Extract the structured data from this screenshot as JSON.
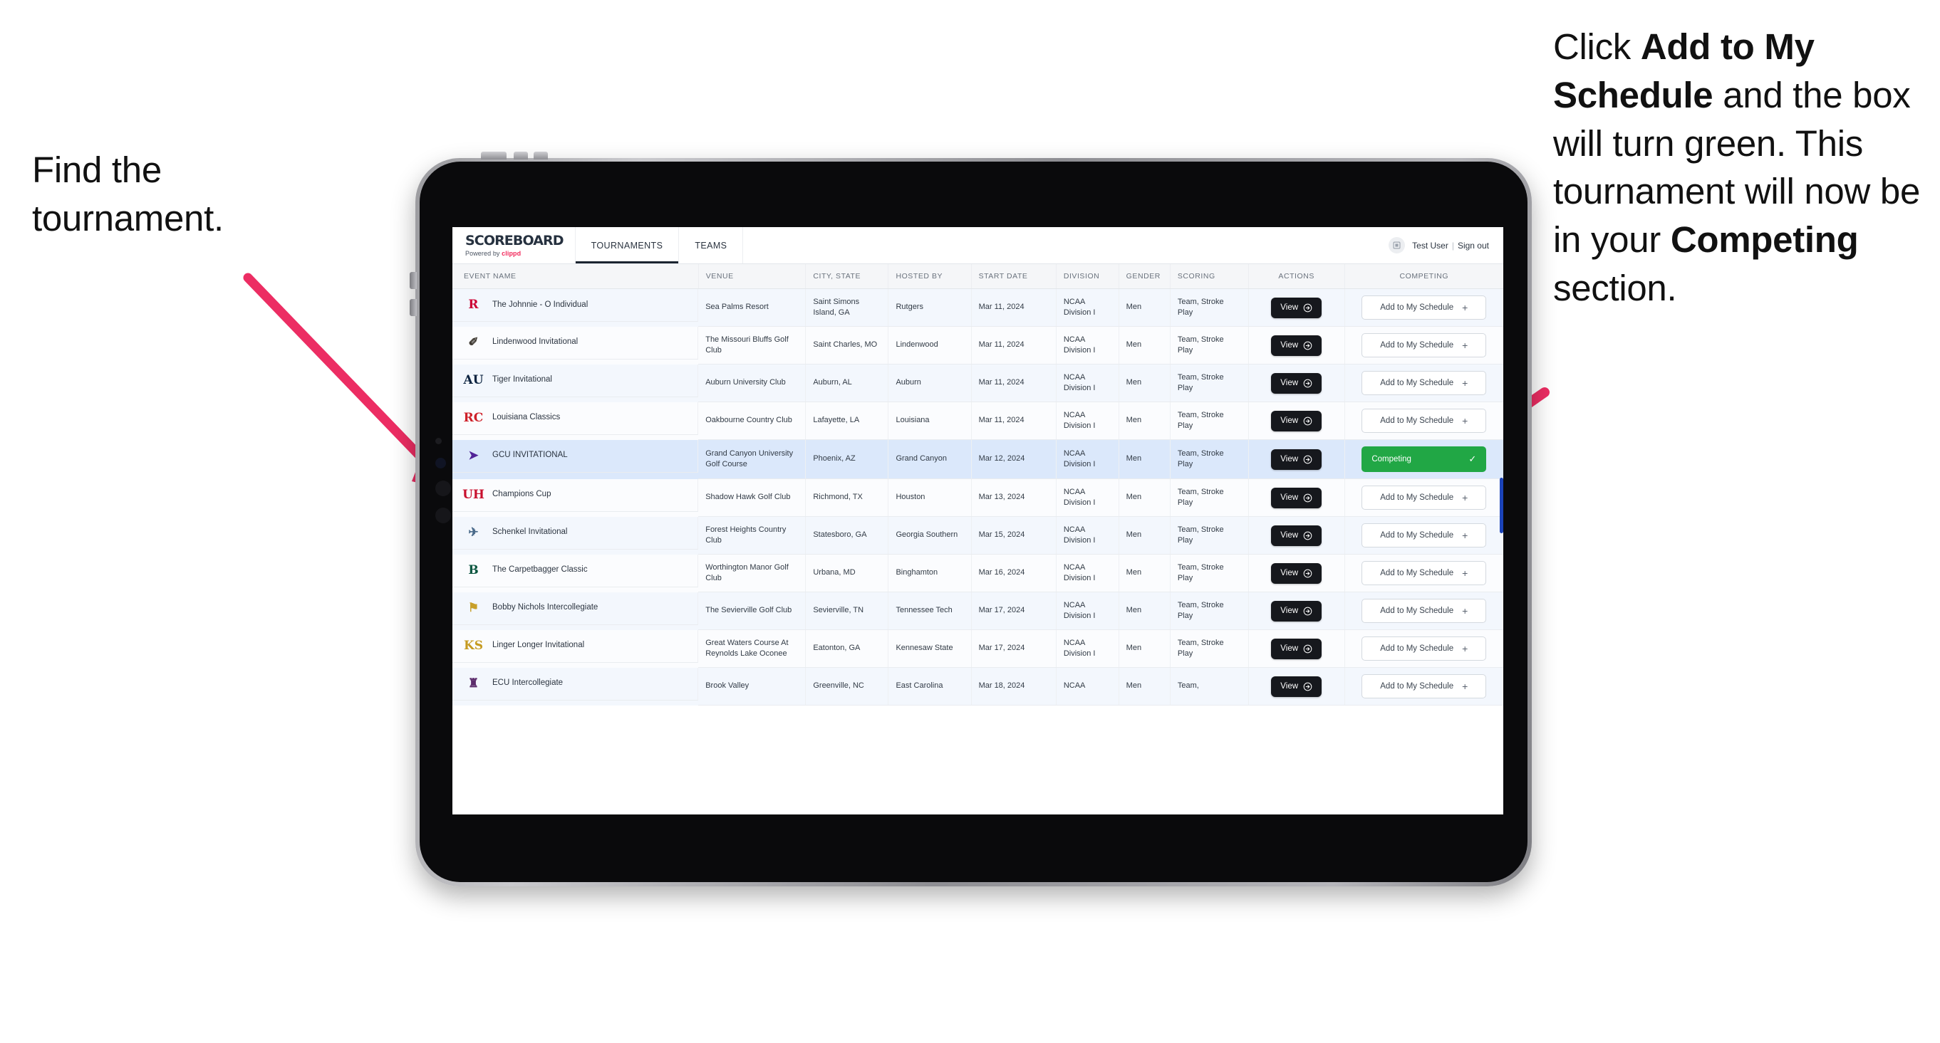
{
  "annotations": {
    "left": {
      "line1": "Find the",
      "line2": "tournament."
    },
    "right": {
      "seg1": "Click ",
      "bold1": "Add to My Schedule",
      "seg2": " and the box will turn green. This tournament will now be in your ",
      "bold2": "Competing",
      "seg3": " section."
    },
    "arrow_color": "#ec2d63"
  },
  "app": {
    "brand": {
      "name": "SCOREBOARD",
      "powered_prefix": "Powered by ",
      "powered_brand": "clippd"
    },
    "tabs": [
      {
        "label": "TOURNAMENTS",
        "active": true
      },
      {
        "label": "TEAMS",
        "active": false
      }
    ],
    "user": {
      "avatar_icon": "user-avatar-icon",
      "name": "Test User",
      "separator": "|",
      "signout": "Sign out"
    },
    "columns": [
      "EVENT NAME",
      "VENUE",
      "CITY, STATE",
      "HOSTED BY",
      "START DATE",
      "DIVISION",
      "GENDER",
      "SCORING",
      "ACTIONS",
      "COMPETING"
    ],
    "buttons": {
      "view": "View",
      "view_icon": "arrow-right-circle-icon",
      "add": "Add to My Schedule",
      "add_icon": "plus-icon",
      "competing": "Competing",
      "competing_icon": "check-icon"
    },
    "colors": {
      "competing_green": "#21a745",
      "accent_pink": "#f2295b",
      "selected_row": "#dbe8fb"
    },
    "rows": [
      {
        "logo_text": "R",
        "logo_fg": "#cc0033",
        "logo_bg": "transparent",
        "event": "The Johnnie - O Individual",
        "venue": "Sea Palms Resort",
        "city": "Saint Simons Island, GA",
        "host": "Rutgers",
        "date": "Mar 11, 2024",
        "division": "NCAA Division I",
        "gender": "Men",
        "scoring": "Team, Stroke Play",
        "competing": false,
        "selected": false
      },
      {
        "logo_text": "✐",
        "logo_fg": "#3f3a33",
        "logo_bg": "transparent",
        "event": "Lindenwood Invitational",
        "venue": "The Missouri Bluffs Golf Club",
        "city": "Saint Charles, MO",
        "host": "Lindenwood",
        "date": "Mar 11, 2024",
        "division": "NCAA Division I",
        "gender": "Men",
        "scoring": "Team, Stroke Play",
        "competing": false,
        "selected": false
      },
      {
        "logo_text": "AU",
        "logo_fg": "#0c2340",
        "logo_bg": "transparent",
        "event": "Tiger Invitational",
        "venue": "Auburn University Club",
        "city": "Auburn, AL",
        "host": "Auburn",
        "date": "Mar 11, 2024",
        "division": "NCAA Division I",
        "gender": "Men",
        "scoring": "Team, Stroke Play",
        "competing": false,
        "selected": false
      },
      {
        "logo_text": "RC",
        "logo_fg": "#ce2029",
        "logo_bg": "transparent",
        "event": "Louisiana Classics",
        "venue": "Oakbourne Country Club",
        "city": "Lafayette, LA",
        "host": "Louisiana",
        "date": "Mar 11, 2024",
        "division": "NCAA Division I",
        "gender": "Men",
        "scoring": "Team, Stroke Play",
        "competing": false,
        "selected": false
      },
      {
        "logo_text": "➤",
        "logo_fg": "#522398",
        "logo_bg": "transparent",
        "event": "GCU INVITATIONAL",
        "venue": "Grand Canyon University Golf Course",
        "city": "Phoenix, AZ",
        "host": "Grand Canyon",
        "date": "Mar 12, 2024",
        "division": "NCAA Division I",
        "gender": "Men",
        "scoring": "Team, Stroke Play",
        "competing": true,
        "selected": true
      },
      {
        "logo_text": "UH",
        "logo_fg": "#c8102e",
        "logo_bg": "transparent",
        "event": "Champions Cup",
        "venue": "Shadow Hawk Golf Club",
        "city": "Richmond, TX",
        "host": "Houston",
        "date": "Mar 13, 2024",
        "division": "NCAA Division I",
        "gender": "Men",
        "scoring": "Team, Stroke Play",
        "competing": false,
        "selected": false
      },
      {
        "logo_text": "✈",
        "logo_fg": "#4a6a8a",
        "logo_bg": "transparent",
        "event": "Schenkel Invitational",
        "venue": "Forest Heights Country Club",
        "city": "Statesboro, GA",
        "host": "Georgia Southern",
        "date": "Mar 15, 2024",
        "division": "NCAA Division I",
        "gender": "Men",
        "scoring": "Team, Stroke Play",
        "competing": false,
        "selected": false
      },
      {
        "logo_text": "B",
        "logo_fg": "#0a5640",
        "logo_bg": "transparent",
        "event": "The Carpetbagger Classic",
        "venue": "Worthington Manor Golf Club",
        "city": "Urbana, MD",
        "host": "Binghamton",
        "date": "Mar 16, 2024",
        "division": "NCAA Division I",
        "gender": "Men",
        "scoring": "Team, Stroke Play",
        "competing": false,
        "selected": false
      },
      {
        "logo_text": "⚑",
        "logo_fg": "#c8a02a",
        "logo_bg": "transparent",
        "event": "Bobby Nichols Intercollegiate",
        "venue": "The Sevierville Golf Club",
        "city": "Sevierville, TN",
        "host": "Tennessee Tech",
        "date": "Mar 17, 2024",
        "division": "NCAA Division I",
        "gender": "Men",
        "scoring": "Team, Stroke Play",
        "competing": false,
        "selected": false
      },
      {
        "logo_text": "KS",
        "logo_fg": "#c59a1f",
        "logo_bg": "transparent",
        "event": "Linger Longer Invitational",
        "venue": "Great Waters Course At Reynolds Lake Oconee",
        "city": "Eatonton, GA",
        "host": "Kennesaw State",
        "date": "Mar 17, 2024",
        "division": "NCAA Division I",
        "gender": "Men",
        "scoring": "Team, Stroke Play",
        "competing": false,
        "selected": false
      },
      {
        "logo_text": "♜",
        "logo_fg": "#5b2b6b",
        "logo_bg": "transparent",
        "event": "ECU Intercollegiate",
        "venue": "Brook Valley",
        "city": "Greenville, NC",
        "host": "East Carolina",
        "date": "Mar 18, 2024",
        "division": "NCAA",
        "gender": "Men",
        "scoring": "Team,",
        "competing": false,
        "selected": false
      }
    ]
  }
}
